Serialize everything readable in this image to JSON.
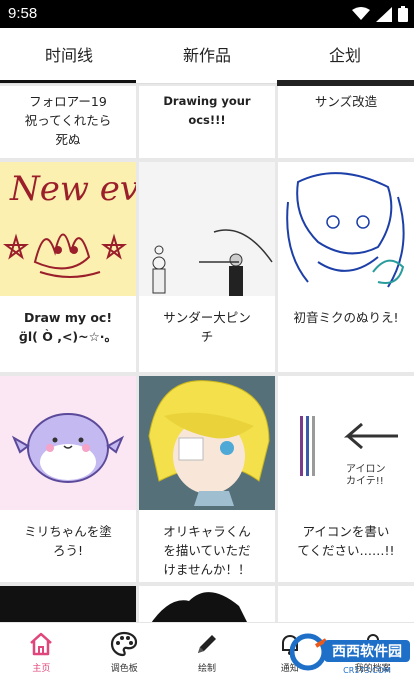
{
  "status": {
    "time": "9:58"
  },
  "tabs": [
    {
      "label": "时间线"
    },
    {
      "label": "新作品"
    },
    {
      "label": "企划"
    }
  ],
  "cards": [
    {
      "caption": "フォロアー19\n祝ってくれたら\n死ぬ"
    },
    {
      "caption": "Drawing your\nocs!!!"
    },
    {
      "caption": "サンズ改造"
    },
    {
      "caption": "Draw my oc!\nɕ̀ ̫ ɕ́ ( Ò ,<)~☆·。",
      "caption_display": "Draw my oc!\n ɡ̈l( Ò ,<)~☆·。"
    },
    {
      "caption": "サンダー大ピン\nチ"
    },
    {
      "caption": "初音ミクのぬりえ!"
    },
    {
      "caption": "ミリちゃんを塗\nろう!"
    },
    {
      "caption": "オリキャラくん\nを描いていただ\nけませんか！！"
    },
    {
      "caption": "アイコンを書い\nてください……!!"
    }
  ],
  "art": {
    "new_event": "New event!",
    "icon_text": "アイロン\nカイテ!!"
  },
  "bottom_nav": [
    {
      "label": "主页",
      "icon": "home-icon"
    },
    {
      "label": "调色板",
      "icon": "palette-icon"
    },
    {
      "label": "绘制",
      "icon": "pencil-icon"
    },
    {
      "label": "通知",
      "icon": "bell-icon"
    },
    {
      "label": "我的档案",
      "icon": "profile-icon"
    }
  ],
  "watermark": {
    "text": "西西软件园",
    "sub": "CR173.COM"
  },
  "colors": {
    "accent": "#e0457b"
  }
}
